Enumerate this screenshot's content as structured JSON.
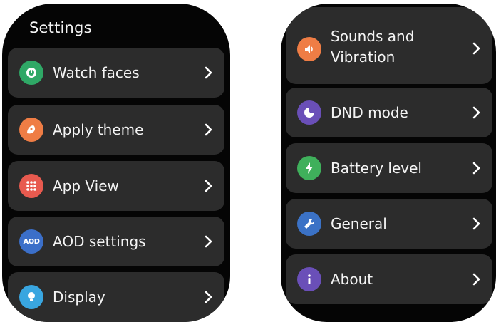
{
  "left_screen": {
    "title": "Settings",
    "items": [
      {
        "label": "Watch faces",
        "icon": "watch-faces-icon",
        "color": "#2fa866"
      },
      {
        "label": "Apply theme",
        "icon": "theme-icon",
        "color": "#ef7d45"
      },
      {
        "label": "App View",
        "icon": "app-grid-icon",
        "color": "#e85a4f"
      },
      {
        "label": "AOD settings",
        "icon": "aod-icon",
        "icon_text": "AOD",
        "color": "#3b6fc9"
      },
      {
        "label": "Display",
        "icon": "display-bulb-icon",
        "color": "#39a6e0"
      }
    ]
  },
  "right_screen": {
    "items": [
      {
        "label": "Sounds and Vibration",
        "icon": "sound-icon",
        "color": "#ef7d45"
      },
      {
        "label": "DND mode",
        "icon": "moon-icon",
        "color": "#6a4fb8"
      },
      {
        "label": "Battery level",
        "icon": "battery-bolt-icon",
        "color": "#3fb05b"
      },
      {
        "label": "General",
        "icon": "wrench-icon",
        "color": "#3b72c6"
      },
      {
        "label": "About",
        "icon": "info-icon",
        "color": "#6a4fb8"
      }
    ]
  }
}
